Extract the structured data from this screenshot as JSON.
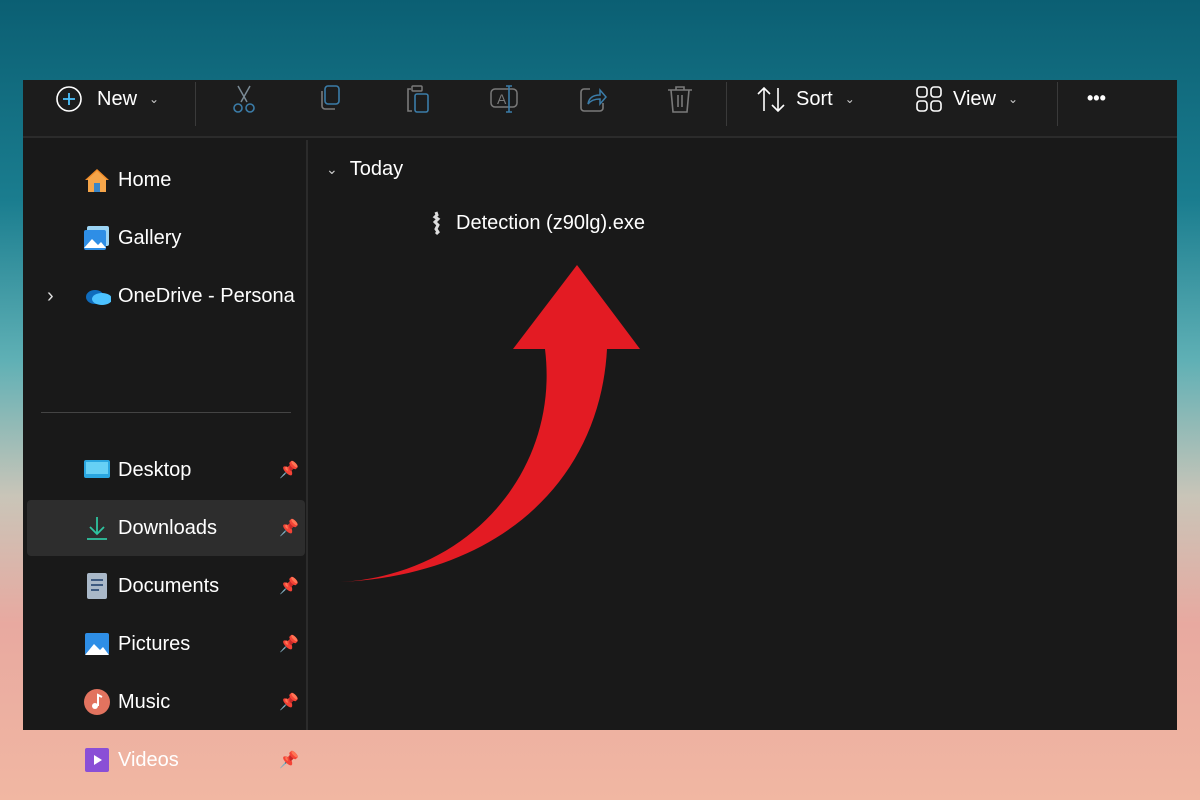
{
  "toolbar": {
    "new_label": "New",
    "sort_label": "Sort",
    "view_label": "View",
    "more_label": "•••"
  },
  "sidebar": {
    "items": [
      {
        "label": "Home",
        "icon": "home-icon"
      },
      {
        "label": "Gallery",
        "icon": "gallery-icon"
      },
      {
        "label": "OneDrive - Persona",
        "icon": "onedrive-icon"
      },
      {
        "label": "Desktop",
        "icon": "desktop-icon"
      },
      {
        "label": "Downloads",
        "icon": "downloads-icon"
      },
      {
        "label": "Documents",
        "icon": "documents-icon"
      },
      {
        "label": "Pictures",
        "icon": "pictures-icon"
      },
      {
        "label": "Music",
        "icon": "music-icon"
      },
      {
        "label": "Videos",
        "icon": "videos-icon"
      }
    ]
  },
  "main": {
    "group_label": "Today",
    "file_name": "Detection (z90lg).exe"
  },
  "colors": {
    "arrow": "#e31b23",
    "accent": "#4cc2ff"
  }
}
